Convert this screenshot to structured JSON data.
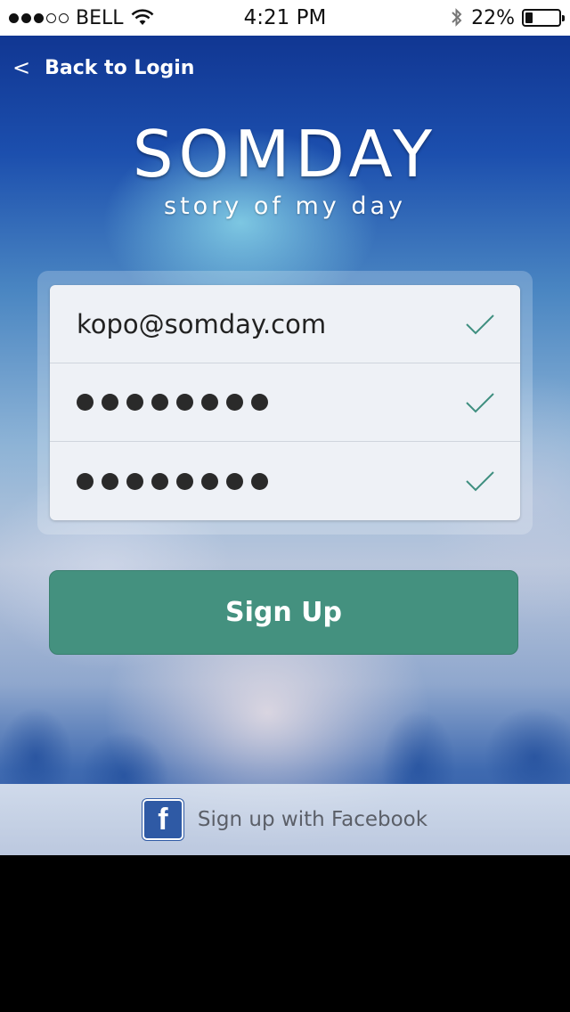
{
  "status_bar": {
    "carrier": "BELL",
    "signal_bars": 5,
    "signal_filled": 3,
    "time": "4:21 PM",
    "battery_percent": "22%",
    "battery_level": 0.22,
    "icons": [
      "wifi-icon",
      "bluetooth-icon",
      "battery-icon"
    ]
  },
  "nav": {
    "back_label": "Back to Login",
    "back_icon": "chevron-left-icon"
  },
  "logo": {
    "title": "SOMDAY",
    "subtitle": "story of my day"
  },
  "form": {
    "email": "kopo@somday.com",
    "password_dots": 8,
    "confirm_dots": 8,
    "check_color": "#3f8f80"
  },
  "signup_button": {
    "label": "Sign Up",
    "color": "#44917f"
  },
  "facebook": {
    "icon_letter": "f",
    "label": "Sign up with Facebook",
    "color": "#2f5aa5"
  }
}
